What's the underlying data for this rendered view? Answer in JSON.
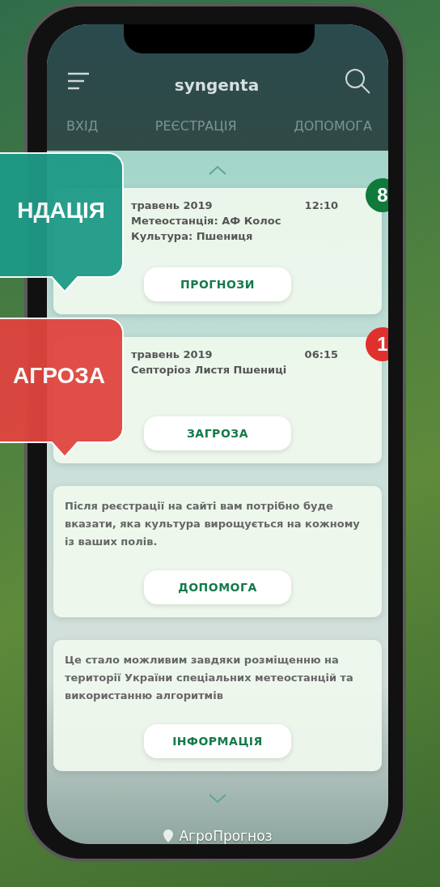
{
  "header": {
    "logo": "syngenta"
  },
  "tabs": [
    {
      "label": "ВХІД",
      "selected": false
    },
    {
      "label": "РЕЄСТРАЦІЯ",
      "selected": false
    },
    {
      "label": "ДОПОМОГА",
      "selected": false
    }
  ],
  "cards": [
    {
      "kind": "event",
      "badge": "8",
      "color": "#0f7a3a",
      "date": "травень 2019",
      "time": "12:10",
      "lines": [
        "Метеостанція: АФ Колос",
        "Культура: Пшениця"
      ],
      "button": "ПРОГНОЗИ"
    },
    {
      "kind": "event",
      "badge": "1",
      "color": "#e0302e",
      "date": "травень 2019",
      "time": "06:15",
      "lines": [
        "Септоріоз Листя Пшениці"
      ],
      "button": "ЗАГРОЗА"
    },
    {
      "kind": "info",
      "text": "Після реєстрації на сайті вам потрібно буде вказати, яка культура вирощується на кожному із ваших полів.",
      "button": "ДОПОМОГА"
    },
    {
      "kind": "info",
      "text": "Це стало можливим завдяки розміщенню на території України спеціальних метеостанцій та використанню алгоритмів",
      "button": "ІНФОРМАЦІЯ"
    }
  ],
  "footer": {
    "label": "АгроПрогноз"
  },
  "callouts": [
    {
      "text": "НДАЦІЯ",
      "color": "#1e9a87"
    },
    {
      "text": "АГРОЗА",
      "color": "#e0453f"
    }
  ]
}
